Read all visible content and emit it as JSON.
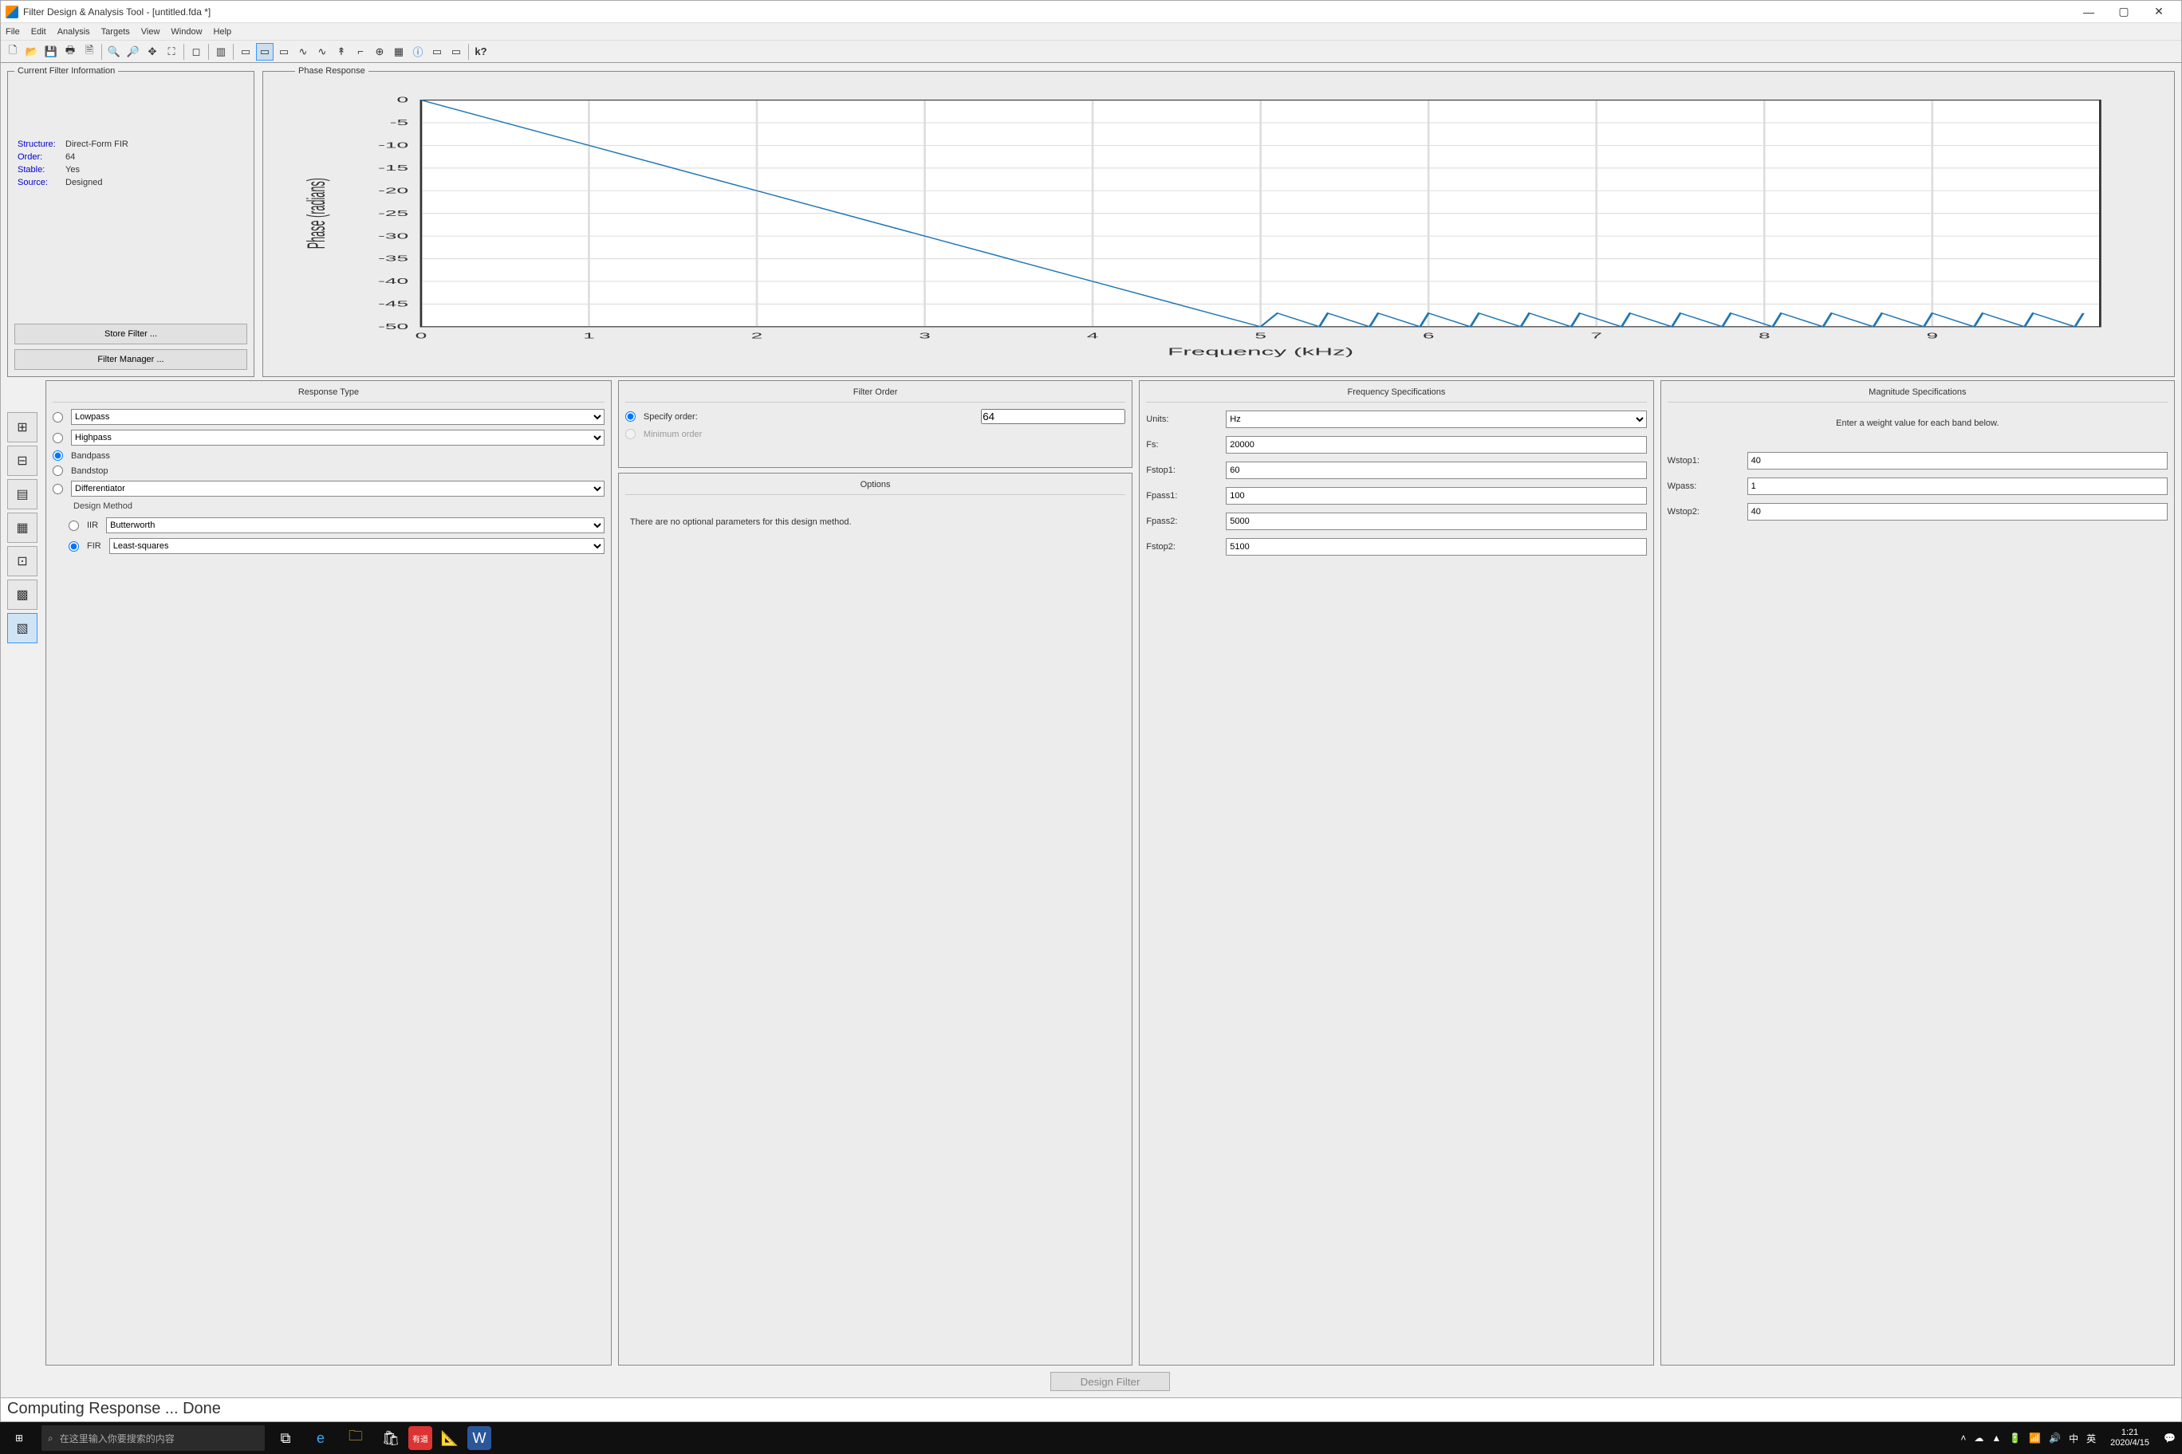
{
  "window": {
    "title": "Filter Design & Analysis Tool -   [untitled.fda *]"
  },
  "menu": {
    "items": [
      "File",
      "Edit",
      "Analysis",
      "Targets",
      "View",
      "Window",
      "Help"
    ]
  },
  "cfi": {
    "legend": "Current Filter Information",
    "structure_label": "Structure:",
    "structure_value": "Direct-Form FIR",
    "order_label": "Order:",
    "order_value": "64",
    "stable_label": "Stable:",
    "stable_value": "Yes",
    "source_label": "Source:",
    "source_value": "Designed",
    "store_btn": "Store Filter ...",
    "manager_btn": "Filter Manager ..."
  },
  "plot": {
    "legend": "Phase Response",
    "xlabel": "Frequency (kHz)",
    "ylabel": "Phase (radians)"
  },
  "response_type": {
    "title": "Response Type",
    "lowpass": "Lowpass",
    "highpass": "Highpass",
    "bandpass": "Bandpass",
    "bandstop": "Bandstop",
    "differentiator": "Differentiator",
    "design_method": "Design Method",
    "iir": "IIR",
    "iir_sel": "Butterworth",
    "fir": "FIR",
    "fir_sel": "Least-squares"
  },
  "filter_order": {
    "title": "Filter Order",
    "specify": "Specify order:",
    "value": "64",
    "minimum": "Minimum order"
  },
  "options": {
    "title": "Options",
    "text": "There are no optional parameters for this design method."
  },
  "freq": {
    "title": "Frequency Specifications",
    "units_label": "Units:",
    "units_value": "Hz",
    "fs_label": "Fs:",
    "fs_value": "20000",
    "fstop1_label": "Fstop1:",
    "fstop1_value": "60",
    "fpass1_label": "Fpass1:",
    "fpass1_value": "100",
    "fpass2_label": "Fpass2:",
    "fpass2_value": "5000",
    "fstop2_label": "Fstop2:",
    "fstop2_value": "5100"
  },
  "mag": {
    "title": "Magnitude Specifications",
    "hint": "Enter a weight value for each band below.",
    "wstop1_label": "Wstop1:",
    "wstop1_value": "40",
    "wpass_label": "Wpass:",
    "wpass_value": "1",
    "wstop2_label": "Wstop2:",
    "wstop2_value": "40"
  },
  "design_btn": "Design Filter",
  "status": "Computing Response ... Done",
  "taskbar": {
    "search_placeholder": "在这里输入你要搜索的内容",
    "time": "1:21",
    "date": "2020/4/15",
    "lang1": "中",
    "lang2": "英"
  },
  "chart_data": {
    "type": "line",
    "title": "Phase Response",
    "xlabel": "Frequency (kHz)",
    "ylabel": "Phase (radians)",
    "xlim": [
      0,
      10
    ],
    "ylim": [
      -50,
      0
    ],
    "xticks": [
      0,
      1,
      2,
      3,
      4,
      5,
      6,
      7,
      8,
      9
    ],
    "yticks": [
      0,
      -5,
      -10,
      -15,
      -20,
      -25,
      -30,
      -35,
      -40,
      -45,
      -50
    ],
    "series": [
      {
        "name": "Phase",
        "x": [
          0,
          0.5,
          1.0,
          1.5,
          2.0,
          2.5,
          3.0,
          3.5,
          4.0,
          4.5,
          5.0,
          5.1,
          5.35,
          5.4,
          5.65,
          5.7,
          5.95,
          6.0,
          6.25,
          6.3,
          6.55,
          6.6,
          6.85,
          6.9,
          7.15,
          7.2,
          7.45,
          7.5,
          7.75,
          7.8,
          8.05,
          8.1,
          8.35,
          8.4,
          8.65,
          8.7,
          8.95,
          9.0,
          9.25,
          9.3,
          9.55,
          9.6,
          9.85,
          9.9
        ],
        "values": [
          0,
          -5,
          -10,
          -15,
          -20,
          -25,
          -30,
          -35,
          -40,
          -45,
          -50,
          -47,
          -50,
          -47,
          -50,
          -47,
          -50,
          -47,
          -50,
          -47,
          -50,
          -47,
          -50,
          -47,
          -50,
          -47,
          -50,
          -47,
          -50,
          -47,
          -50,
          -47,
          -50,
          -47,
          -50,
          -47,
          -50,
          -47,
          -50,
          -47,
          -50,
          -47,
          -50,
          -47
        ]
      }
    ]
  }
}
